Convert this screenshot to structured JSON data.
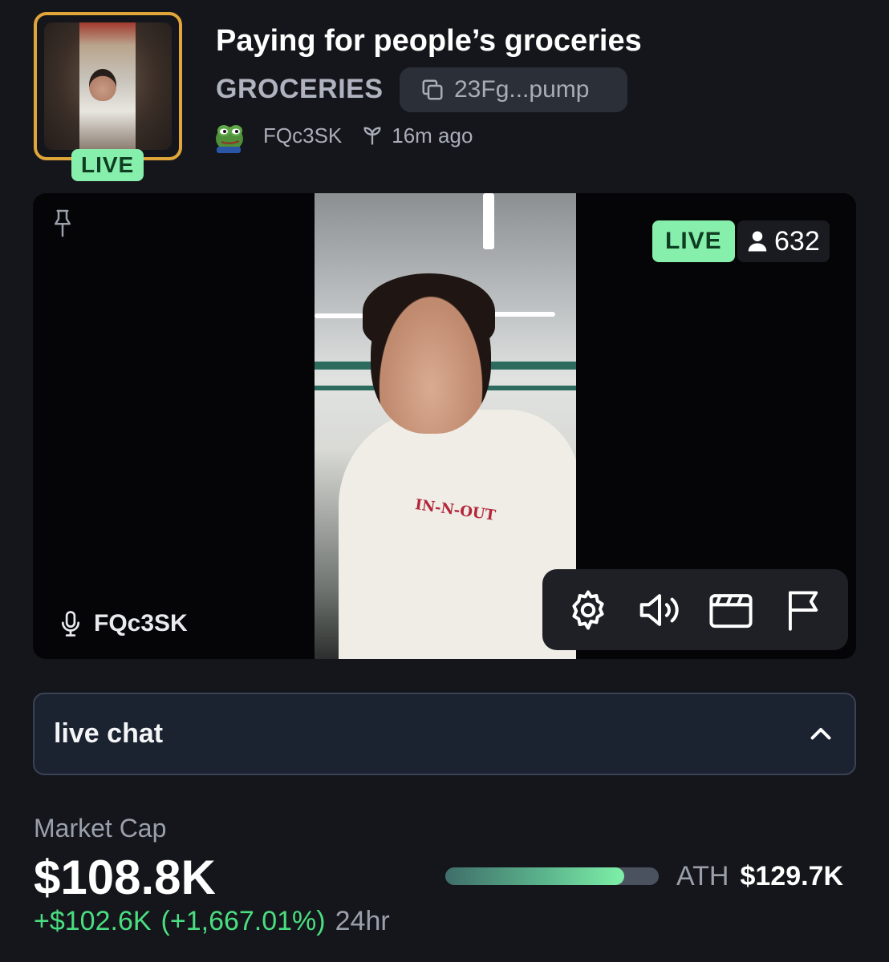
{
  "header": {
    "thumbnail_badge": "LIVE",
    "title": "Paying for people’s groceries",
    "ticker": "GROCERIES",
    "contract_address": "23Fg...pump",
    "creator": "FQc3SK",
    "age": "16m ago"
  },
  "stream": {
    "live_label": "LIVE",
    "viewer_count": "632",
    "streamer_name": "FQc3SK",
    "shirt_logo_text": "IN-N-OUT",
    "controls": [
      "settings",
      "volume",
      "theater-mode",
      "report"
    ]
  },
  "chat": {
    "label": "live chat"
  },
  "market": {
    "label": "Market Cap",
    "value": "$108.8K",
    "change_amount": "+$102.6K",
    "change_percent": "(+1,667.01%)",
    "period": "24hr",
    "ath_label": "ATH",
    "ath_value": "$129.7K",
    "ath_progress": 0.84
  },
  "colors": {
    "background": "#15161b",
    "live_green": "#86efac",
    "thumb_border": "#e0a63a",
    "positive": "#4ade80"
  }
}
